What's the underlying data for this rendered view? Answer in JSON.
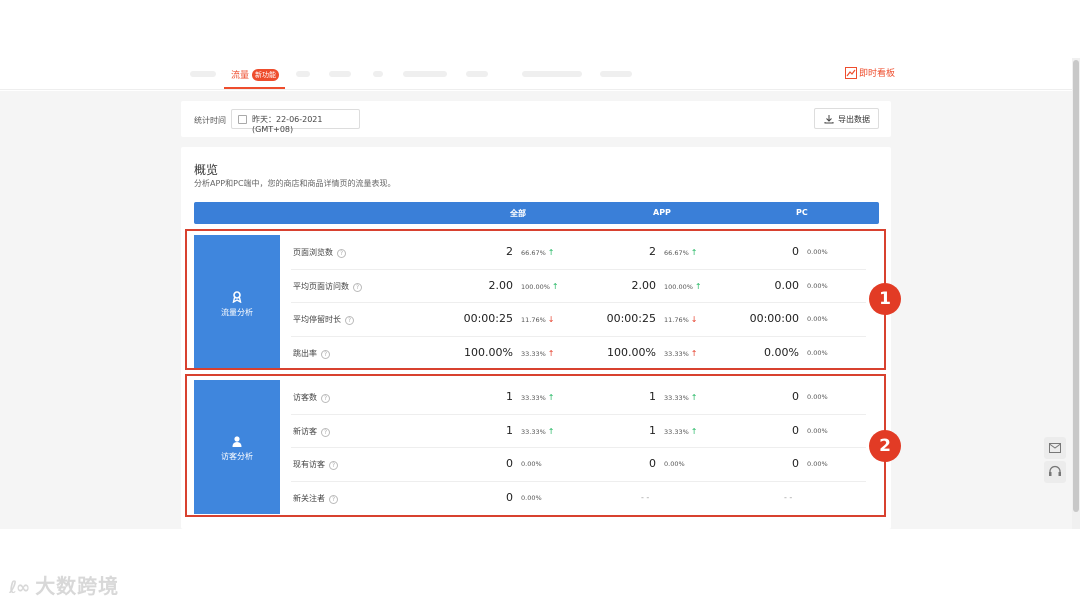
{
  "nav": {
    "tab_active": "流量",
    "tab_active_badge": "新功能",
    "realtime_label": "即时看板"
  },
  "filter": {
    "stat_label": "统计时间",
    "date_value": "昨天：22-06-2021 (GMT+08)",
    "export_label": "导出数据"
  },
  "overview": {
    "title": "概览",
    "subtitle": "分析APP和PC端中，您的商店和商品详情页的流量表现。",
    "col_all": "全部",
    "col_app": "APP",
    "col_pc": "PC"
  },
  "traffic": {
    "section_label": "流量分析",
    "rows": [
      {
        "label": "页面浏览数",
        "all": "2",
        "all_pct": "66.67%",
        "all_dir": "up",
        "app": "2",
        "app_pct": "66.67%",
        "app_dir": "up",
        "pc": "0",
        "pc_pct": "0.00%",
        "pc_dir": ""
      },
      {
        "label": "平均页面访问数",
        "all": "2.00",
        "all_pct": "100.00%",
        "all_dir": "up",
        "app": "2.00",
        "app_pct": "100.00%",
        "app_dir": "up",
        "pc": "0.00",
        "pc_pct": "0.00%",
        "pc_dir": ""
      },
      {
        "label": "平均停留时长",
        "all": "00:00:25",
        "all_pct": "11.76%",
        "all_dir": "down",
        "app": "00:00:25",
        "app_pct": "11.76%",
        "app_dir": "down",
        "pc": "00:00:00",
        "pc_pct": "0.00%",
        "pc_dir": ""
      },
      {
        "label": "跳出率",
        "all": "100.00%",
        "all_pct": "33.33%",
        "all_dir": "up-red",
        "app": "100.00%",
        "app_pct": "33.33%",
        "app_dir": "up-red",
        "pc": "0.00%",
        "pc_pct": "0.00%",
        "pc_dir": ""
      }
    ]
  },
  "visitors": {
    "section_label": "访客分析",
    "rows": [
      {
        "label": "访客数",
        "all": "1",
        "all_pct": "33.33%",
        "all_dir": "up",
        "app": "1",
        "app_pct": "33.33%",
        "app_dir": "up",
        "pc": "0",
        "pc_pct": "0.00%",
        "pc_dir": ""
      },
      {
        "label": "新访客",
        "all": "1",
        "all_pct": "33.33%",
        "all_dir": "up",
        "app": "1",
        "app_pct": "33.33%",
        "app_dir": "up",
        "pc": "0",
        "pc_pct": "0.00%",
        "pc_dir": ""
      },
      {
        "label": "现有访客",
        "all": "0",
        "all_pct": "0.00%",
        "all_dir": "",
        "app": "0",
        "app_pct": "0.00%",
        "app_dir": "",
        "pc": "0",
        "pc_pct": "0.00%",
        "pc_dir": ""
      },
      {
        "label": "新关注者",
        "all": "0",
        "all_pct": "0.00%",
        "all_dir": "",
        "app": "- -",
        "app_pct": "",
        "app_dir": "",
        "pc": "- -",
        "pc_pct": "",
        "pc_dir": ""
      }
    ]
  },
  "annotations": {
    "one": "1",
    "two": "2"
  },
  "watermark": {
    "text": "大数跨境"
  },
  "colors": {
    "accent": "#ee4d2d",
    "header_blue": "#3a7fd8",
    "up": "#25b864",
    "down": "#e5402c"
  }
}
